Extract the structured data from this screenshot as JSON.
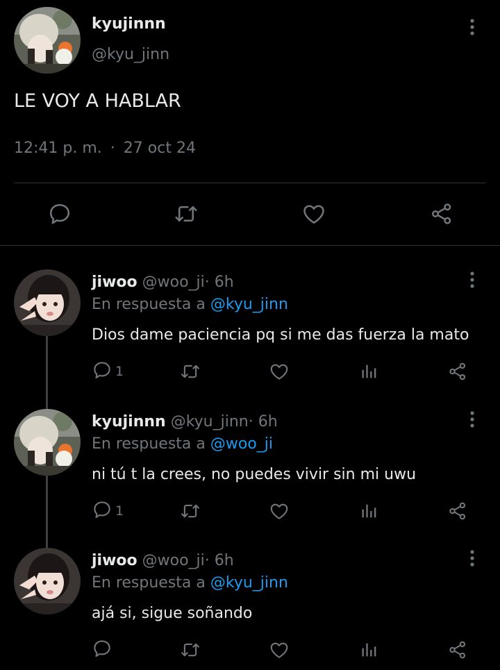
{
  "main_tweet": {
    "name": "kyujinnn",
    "handle": "@kyu_jinn",
    "text": "LE VOY A HABLAR",
    "time": "12:41 p. m.",
    "separator": "·",
    "date": "27 oct 24",
    "avatar": "avatar-kyujinnn",
    "actions": [
      "reply-icon",
      "retweet-icon",
      "like-icon",
      "share-icon"
    ]
  },
  "replies": [
    {
      "name": "jiwoo",
      "handle": "@woo_ji",
      "separator": "·",
      "time": "6h",
      "reply_prefix": "En respuesta a",
      "reply_to": "@kyu_jinn",
      "text": "Dios dame paciencia pq si me das fuerza la mato",
      "reply_count": "1",
      "avatar": "avatar-jiwoo"
    },
    {
      "name": "kyujinnn",
      "handle": "@kyu_jinn",
      "separator": "·",
      "time": "6h",
      "reply_prefix": "En respuesta a",
      "reply_to": "@woo_ji",
      "text": "ni tú t la crees, no puedes vivir sin mi uwu",
      "reply_count": "1",
      "avatar": "avatar-kyujinnn"
    },
    {
      "name": "jiwoo",
      "handle": "@woo_ji",
      "separator": "·",
      "time": "6h",
      "reply_prefix": "En respuesta a",
      "reply_to": "@kyu_jinn",
      "text": "ajá si, sigue soñando",
      "reply_count": "",
      "avatar": "avatar-jiwoo"
    }
  ],
  "colors": {
    "background": "#000000",
    "text": "#e7e9ea",
    "secondary": "#71767b",
    "link": "#1d9bf0",
    "divider": "#2f3336"
  }
}
